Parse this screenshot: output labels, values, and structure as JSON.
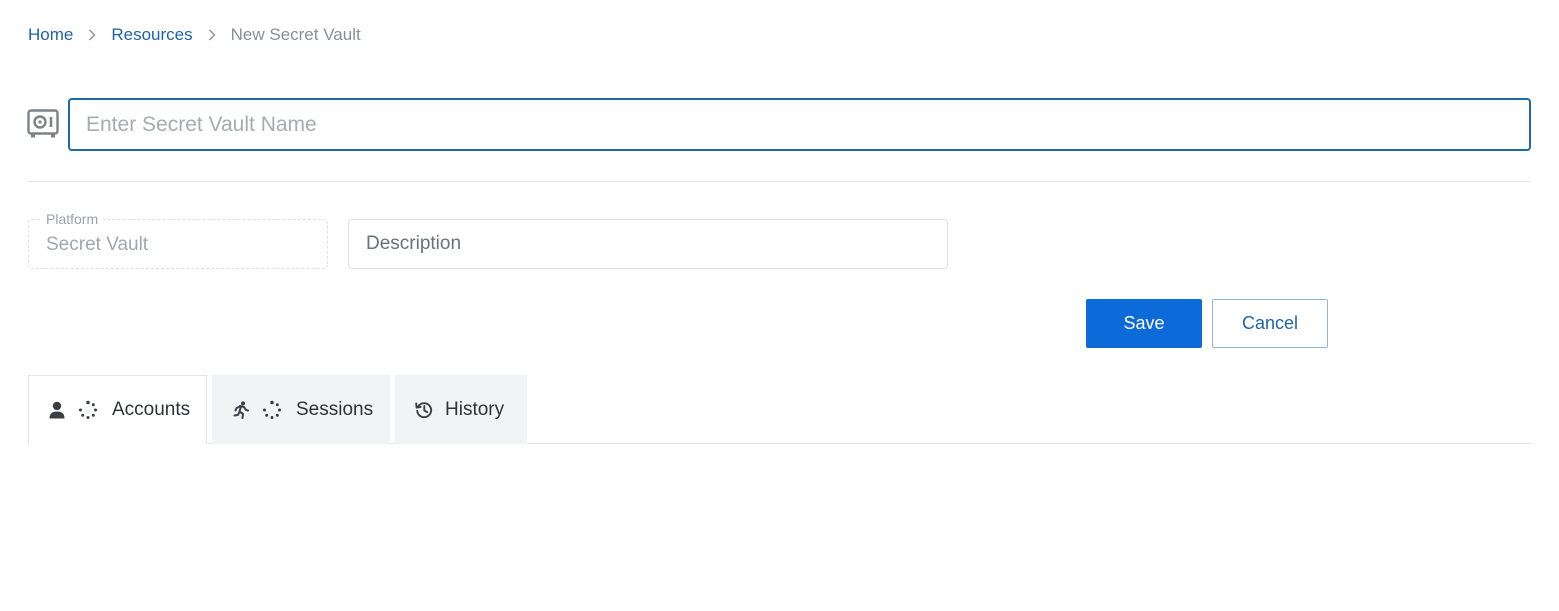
{
  "breadcrumb": {
    "home": "Home",
    "resources": "Resources",
    "current": "New Secret Vault"
  },
  "icons": {
    "breadcrumb_separator": "chevron-right-icon",
    "vault": "vault-icon",
    "accounts": "user-icon",
    "sessions": "running-person-icon",
    "history": "history-icon",
    "loading": "spinner-icon"
  },
  "name_field": {
    "placeholder": "Enter Secret Vault Name",
    "value": ""
  },
  "platform": {
    "label": "Platform",
    "value": "Secret Vault"
  },
  "description": {
    "placeholder": "Description",
    "value": ""
  },
  "actions": {
    "save_label": "Save",
    "cancel_label": "Cancel"
  },
  "tabs": [
    {
      "label": "Accounts",
      "active": true
    },
    {
      "label": "Sessions",
      "active": false
    },
    {
      "label": "History",
      "active": false
    }
  ],
  "colors": {
    "link": "#1f63a8",
    "primary": "#0c6bd8",
    "input_focus_border": "#1e6aa6"
  }
}
